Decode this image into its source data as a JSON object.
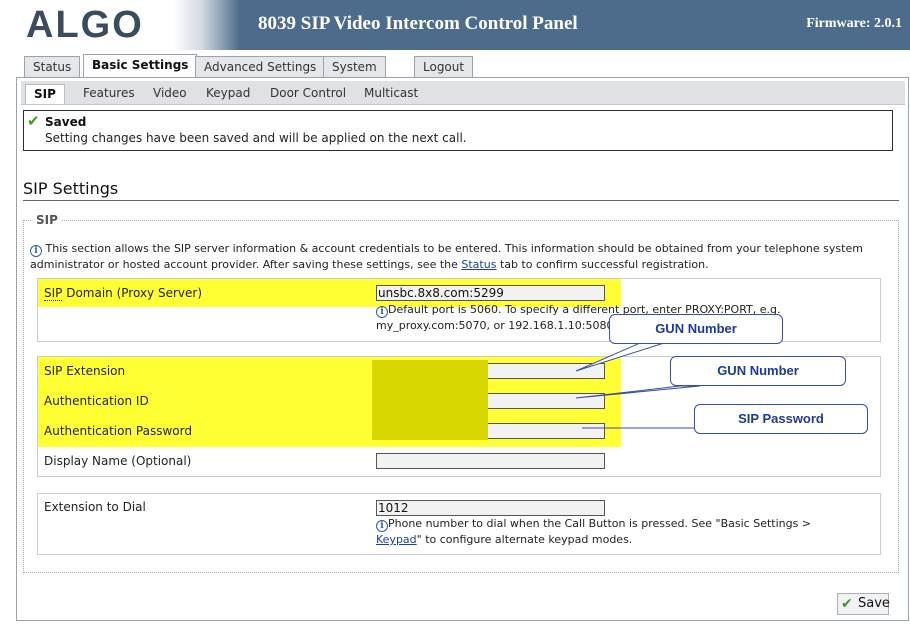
{
  "header": {
    "logo": "ALGO",
    "title": "8039 SIP Video Intercom Control Panel",
    "firmware": "Firmware: 2.0.1",
    "background_color": "#4d6b8a"
  },
  "main_tabs": [
    {
      "label": "Status"
    },
    {
      "label": "Basic Settings",
      "active": true
    },
    {
      "label": "Advanced Settings"
    },
    {
      "label": "System"
    },
    {
      "label": "Logout"
    }
  ],
  "sub_tabs": [
    {
      "label": "SIP",
      "active": true
    },
    {
      "label": "Features"
    },
    {
      "label": "Video"
    },
    {
      "label": "Keypad"
    },
    {
      "label": "Door Control"
    },
    {
      "label": "Multicast"
    }
  ],
  "notice": {
    "icon": "checkmark-icon",
    "title": "Saved",
    "text": "Setting changes have been saved and will be applied on the next call."
  },
  "section": {
    "heading": "SIP Settings",
    "legend": "SIP",
    "description_pre": "This section allows the SIP server information & account credentials to be entered. This information should be obtained from your telephone system administrator or hosted account provider. After saving these settings, see the ",
    "description_link": "Status",
    "description_post": " tab to confirm successful registration."
  },
  "fields": {
    "sip_domain": {
      "label_abbr": "SIP",
      "label_rest": " Domain (Proxy Server)",
      "value": "unsbc.8x8.com:5299",
      "help": "Default port is 5060. To specify a different port, enter PROXY:PORT, e.g. my_proxy.com:5070, or 192.168.1.10:5080"
    },
    "sip_extension": {
      "label": "SIP Extension",
      "value": ""
    },
    "auth_id": {
      "label": "Authentication ID",
      "value": ""
    },
    "auth_password": {
      "label": "Authentication Password",
      "value": ""
    },
    "display_name": {
      "label": "Display Name (Optional)",
      "value": ""
    },
    "ext_to_dial": {
      "label": "Extension to Dial",
      "value": "1012",
      "help_pre": "Phone number to dial when the Call Button is pressed. See \"Basic Settings > ",
      "help_link": "Keypad",
      "help_post": "\" to configure alternate keypad modes."
    }
  },
  "callouts": {
    "gun_number_1": "GUN Number",
    "gun_number_2": "GUN Number",
    "sip_password": "SIP Password"
  },
  "save_button": {
    "label": "Save",
    "icon": "checkmark-icon"
  },
  "colors": {
    "highlight": "#ffff33",
    "accent_green": "#3a9d23",
    "link": "#1a3ea8"
  }
}
